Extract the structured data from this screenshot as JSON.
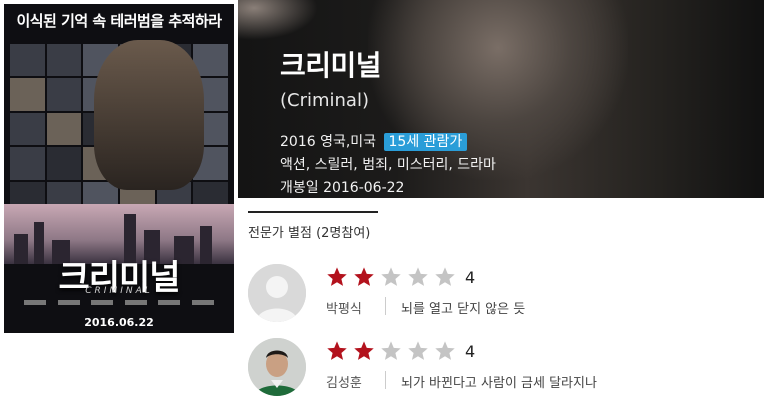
{
  "poster": {
    "headline": "이식된 기억 속 테러범을 추적하라",
    "title_ko": "크리미널",
    "title_en": "CRIMINAL",
    "release_date": "2016.06.22"
  },
  "movie": {
    "title": "크리미널",
    "original_title": "(Criminal)",
    "year_country": "2016 영국,미국",
    "rating_badge": "15세 관람가",
    "genres": "액션, 스릴러, 범죄, 미스터리, 드라마",
    "release": "개봉일 2016-06-22",
    "badge_color": "#2a9dd8"
  },
  "critics_section": {
    "heading": "전문가 별점 (2명참여)"
  },
  "critics": [
    {
      "name": "박평식",
      "score": "4",
      "stars_filled": 2,
      "stars_total": 5,
      "comment": "뇌를 열고 닫지 않은 듯",
      "avatar": "default-avatar-icon"
    },
    {
      "name": "김성훈",
      "score": "4",
      "stars_filled": 2,
      "stars_total": 5,
      "comment": "뇌가 바뀐다고 사람이 금세 달라지나",
      "avatar": "person-photo"
    }
  ],
  "colors": {
    "star_filled": "#b3121d",
    "star_empty": "#c4c4c4"
  }
}
